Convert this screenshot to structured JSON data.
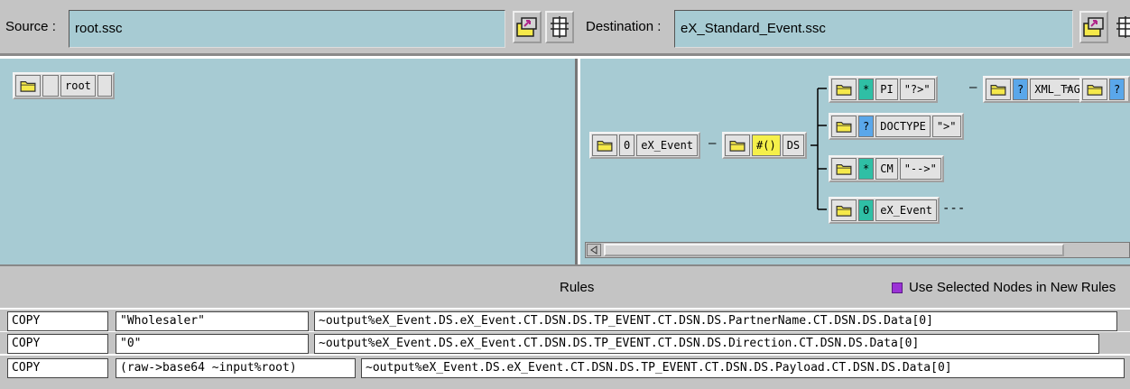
{
  "source": {
    "label": "Source :",
    "file": "root.ssc"
  },
  "destination": {
    "label": "Destination :",
    "file": "eX_Standard_Event.ssc"
  },
  "source_tree": {
    "root": {
      "name": "root"
    }
  },
  "dest_tree": {
    "root": {
      "min": "0",
      "name": "eX_Event"
    },
    "ds": {
      "occ": "#()",
      "name": "DS"
    },
    "children": [
      {
        "occ": "*",
        "name": "PI",
        "delim": "\"?>\"",
        "next_occ": "?",
        "next_name": "XML_TAG",
        "next2_occ": "?"
      },
      {
        "occ": "?",
        "name": "DOCTYPE",
        "delim": "\">\""
      },
      {
        "occ": "*",
        "name": "CM",
        "delim": "\"-->\""
      },
      {
        "occ": "0",
        "name": "eX_Event",
        "trailer": "---"
      }
    ],
    "dash": "—"
  },
  "rules": {
    "title": "Rules",
    "checkbox_label": "Use Selected Nodes in New Rules",
    "checkbox_checked": true,
    "rows": [
      {
        "op": "COPY",
        "src": "\"Wholesaler\"",
        "dst": "~output%eX_Event.DS.eX_Event.CT.DSN.DS.TP_EVENT.CT.DSN.DS.PartnerName.CT.DSN.DS.Data[0]"
      },
      {
        "op": "COPY",
        "src": "\"0\"",
        "dst": "~output%eX_Event.DS.eX_Event.CT.DSN.DS.TP_EVENT.CT.DSN.DS.Direction.CT.DSN.DS.Data[0]"
      },
      {
        "op": "COPY",
        "src": "(raw->base64 ~input%root)",
        "dst": "~output%eX_Event.DS.eX_Event.CT.DSN.DS.TP_EVENT.CT.DSN.DS.Payload.CT.DSN.DS.Data[0]"
      }
    ]
  },
  "colors": {
    "pane": "#a7cbd3",
    "chrome": "#c4c4c4",
    "occ_yellow": "#f5f04a",
    "occ_teal": "#2fbfa5",
    "occ_blue": "#5aa7ea"
  },
  "icons": [
    "folder-icon",
    "open-file-icon",
    "split-view-icon",
    "checkbox-icon",
    "scroll-left-icon"
  ]
}
